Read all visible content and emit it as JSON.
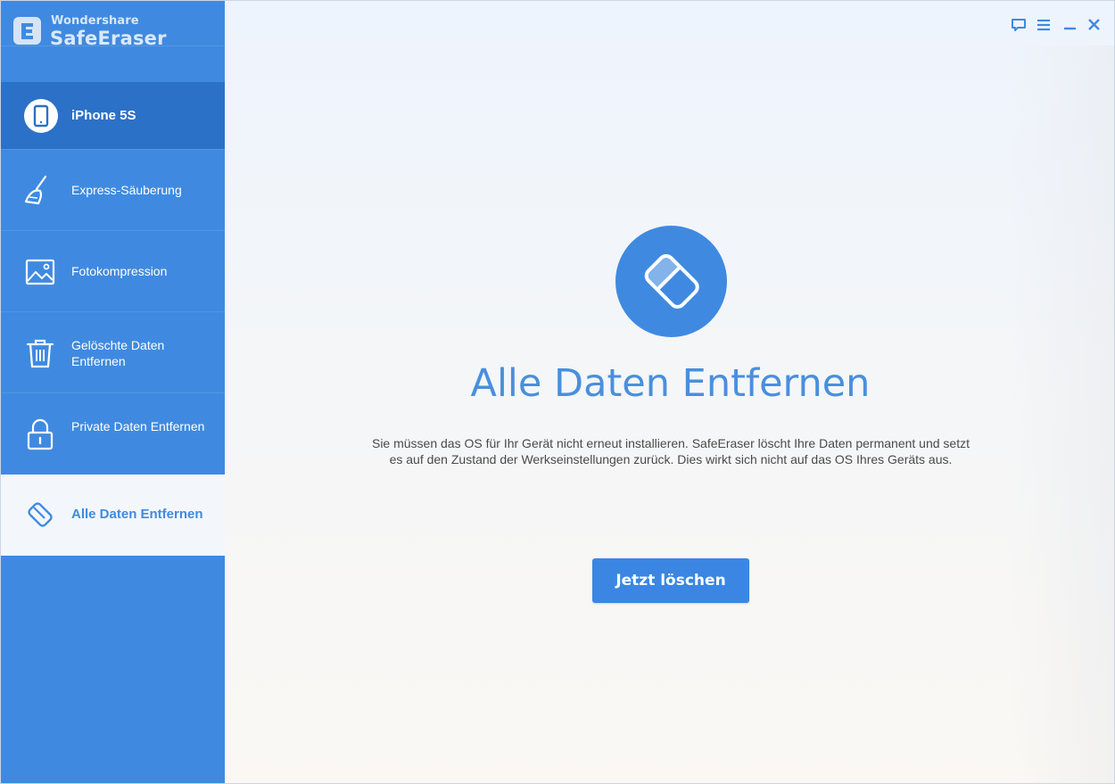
{
  "app": {
    "brand_top": "Wondershare",
    "brand_name": "SafeEraser"
  },
  "device": {
    "name": "iPhone 5S",
    "icon": "phone-icon"
  },
  "sidebar": {
    "items": [
      {
        "label": "Express-Säuberung",
        "icon": "broom-icon",
        "active": false
      },
      {
        "label": "Fotokompression",
        "icon": "image-icon",
        "active": false
      },
      {
        "label": "Gelöschte Daten Entfernen",
        "icon": "trash-icon",
        "active": false
      },
      {
        "label": "Private Daten Entfernen",
        "icon": "lock-icon",
        "active": false
      },
      {
        "label": "Alle Daten Entfernen",
        "icon": "eraser-icon",
        "active": true
      }
    ]
  },
  "window_controls": [
    "feedback-icon",
    "menu-icon",
    "minimize-icon",
    "close-icon"
  ],
  "main": {
    "title": "Alle Daten Entfernen",
    "description": "Sie müssen das OS für Ihr Gerät nicht erneut installieren. SafeEraser löscht Ihre Daten permanent und setzt es auf den Zustand der Werkseinstellungen zurück. Dies wirkt sich nicht auf das OS Ihres Geräts aus.",
    "button_label": "Jetzt löschen",
    "icon": "eraser-icon"
  },
  "colors": {
    "accent": "#3f8ae0",
    "sidebar_selected": "#2b71c8",
    "active_bg": "#f3f7fc"
  }
}
